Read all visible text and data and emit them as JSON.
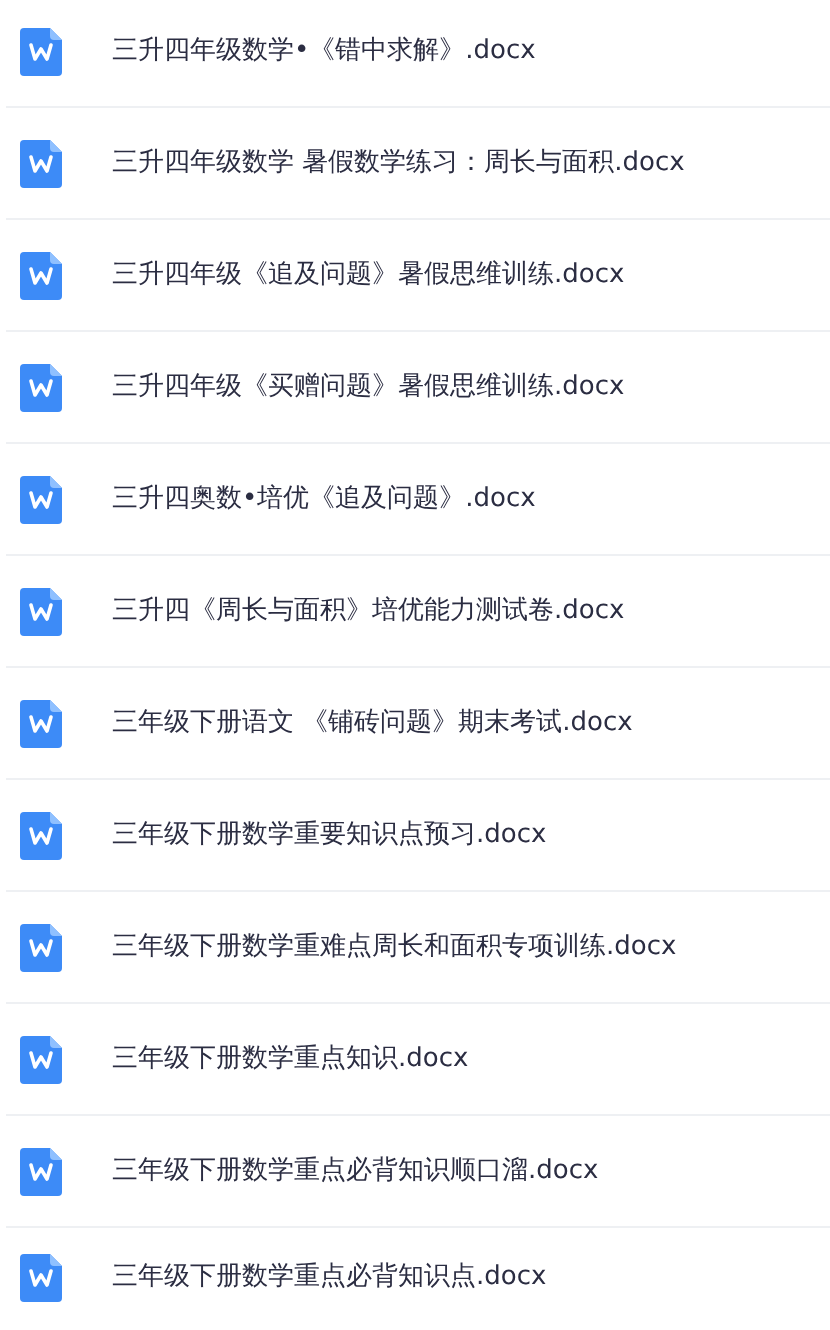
{
  "files": [
    {
      "name": "三升四年级数学•《错中求解》.docx"
    },
    {
      "name": "三升四年级数学 暑假数学练习：周长与面积.docx"
    },
    {
      "name": "三升四年级《追及问题》暑假思维训练.docx"
    },
    {
      "name": "三升四年级《买赠问题》暑假思维训练.docx"
    },
    {
      "name": "三升四奥数•培优《追及问题》.docx"
    },
    {
      "name": "三升四《周长与面积》培优能力测试卷.docx"
    },
    {
      "name": "三年级下册语文 《铺砖问题》期末考试.docx"
    },
    {
      "name": "三年级下册数学重要知识点预习.docx"
    },
    {
      "name": "三年级下册数学重难点周长和面积专项训练.docx"
    },
    {
      "name": "三年级下册数学重点知识.docx"
    },
    {
      "name": "三年级下册数学重点必背知识顺口溜.docx"
    },
    {
      "name": "三年级下册数学重点必背知识点.docx"
    }
  ]
}
